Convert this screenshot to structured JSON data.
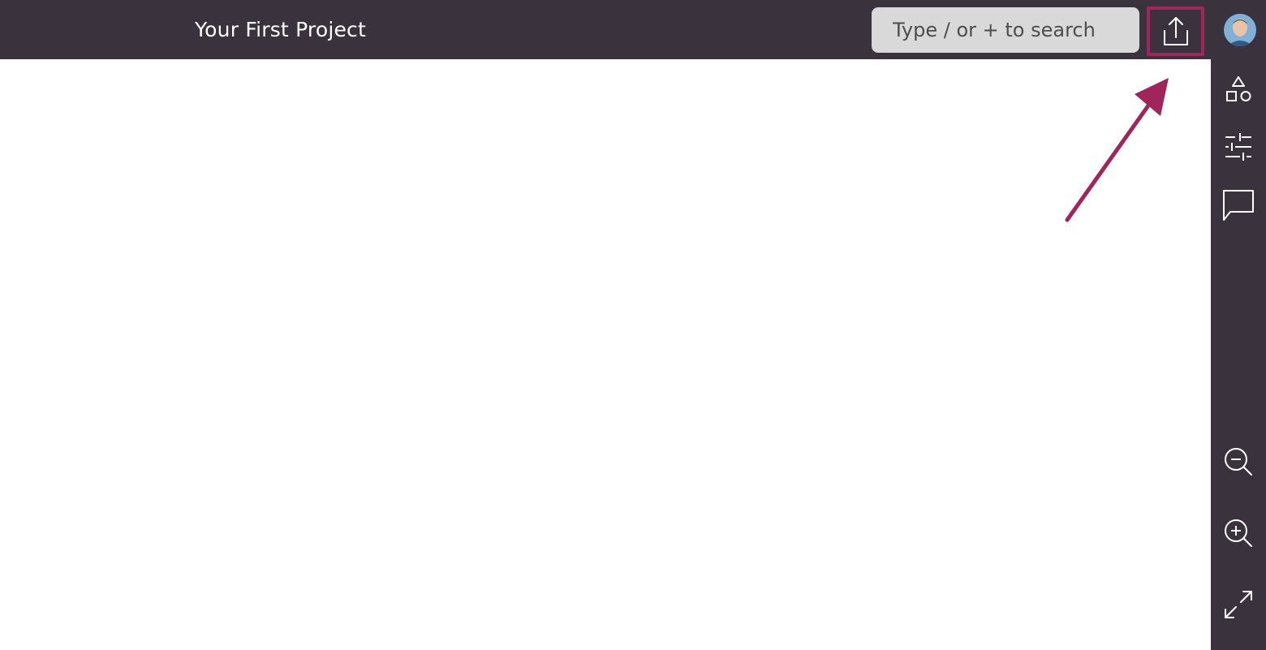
{
  "header": {
    "project_title": "Your First Project",
    "search_placeholder": "Type / or + to search"
  },
  "icons": {
    "share": "share-icon",
    "avatar": "avatar",
    "shapes": "shapes-icon",
    "adjustments": "sliders-icon",
    "comments": "comment-icon",
    "zoom_out": "zoom-out-icon",
    "zoom_in": "zoom-in-icon",
    "fullscreen": "expand-icon"
  },
  "colors": {
    "bar_background": "#3a333e",
    "highlight": "#a0255a",
    "search_background": "#d9d9d9"
  }
}
